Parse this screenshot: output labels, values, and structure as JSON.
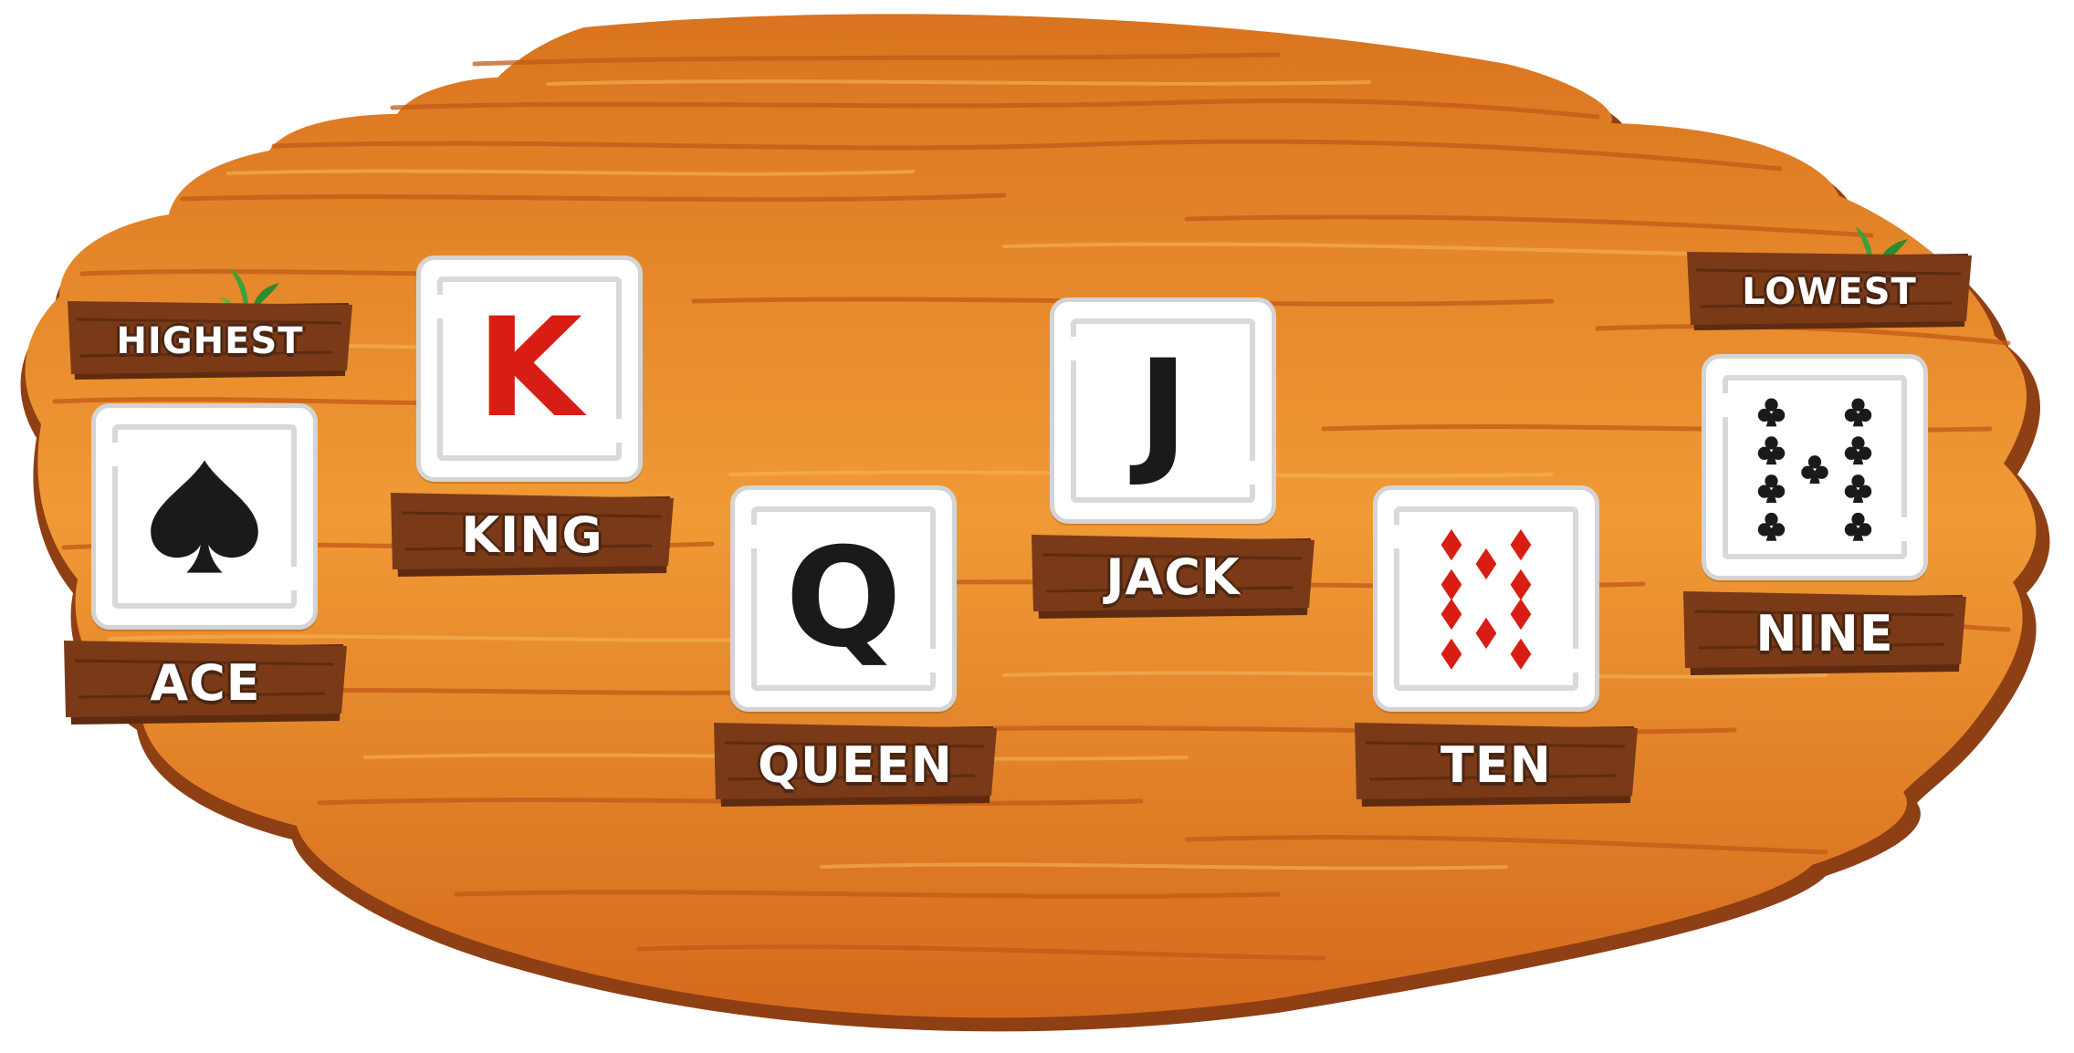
{
  "board": {
    "wood_color": "#e98a2a",
    "wood_dark": "#c9611b",
    "edge_color": "#8f3f14",
    "plank_color": "#7a3a18"
  },
  "tags": {
    "highest": "HIGHEST",
    "lowest": "LOWEST"
  },
  "cards": [
    {
      "rank_name": "ACE",
      "symbol": "spade-icon",
      "color": "#1a1a1a"
    },
    {
      "rank_name": "KING",
      "rank": "K",
      "color": "#d81e14"
    },
    {
      "rank_name": "QUEEN",
      "rank": "Q",
      "color": "#1a1a1a"
    },
    {
      "rank_name": "JACK",
      "rank": "J",
      "color": "#1a1a1a"
    },
    {
      "rank_name": "TEN",
      "symbol": "diamond-icon",
      "pips": 10,
      "color": "#d81e14"
    },
    {
      "rank_name": "NINE",
      "symbol": "club-icon",
      "pips": 9,
      "color": "#1a1a1a"
    }
  ]
}
